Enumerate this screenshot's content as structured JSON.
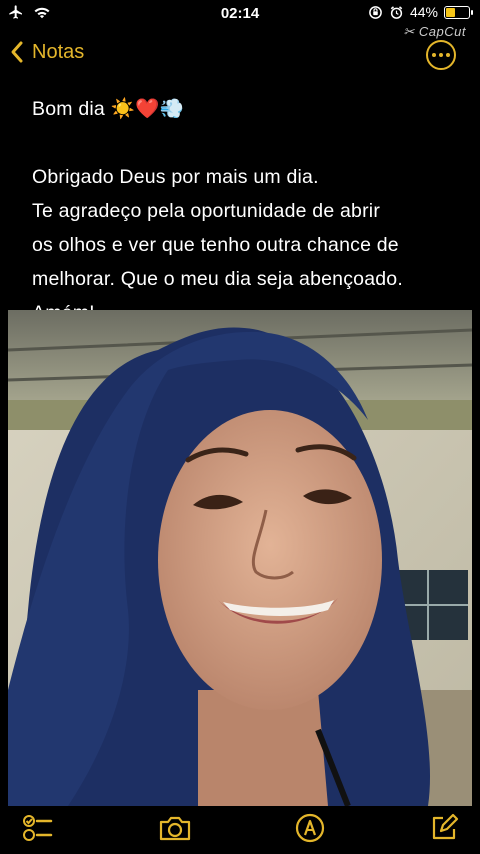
{
  "status_bar": {
    "time": "02:14",
    "battery": "44%",
    "battery_level": 0.44,
    "icons": [
      "airplane-icon",
      "wifi-icon",
      "orientation-lock-icon",
      "alarm-icon",
      "battery-icon"
    ]
  },
  "watermark": "CapCut",
  "nav": {
    "back_label": "Notas",
    "more_icon": "ellipsis-circle-icon"
  },
  "note": {
    "greeting": "Bom dia ☀️❤️💨",
    "lines": [
      "Obrigado Deus por mais um dia.",
      "Te agradeço pela oportunidade de abrir",
      "os olhos e ver que tenho outra chance de",
      "melhorar. Que o meu dia seja abençoado.",
      "Amém!"
    ]
  },
  "toolbar": {
    "icons": [
      "checklist-icon",
      "camera-icon",
      "markup-pen-icon",
      "compose-icon"
    ]
  },
  "colors": {
    "accent": "#e4b62b",
    "background": "#000000",
    "text": "#ffffff"
  }
}
